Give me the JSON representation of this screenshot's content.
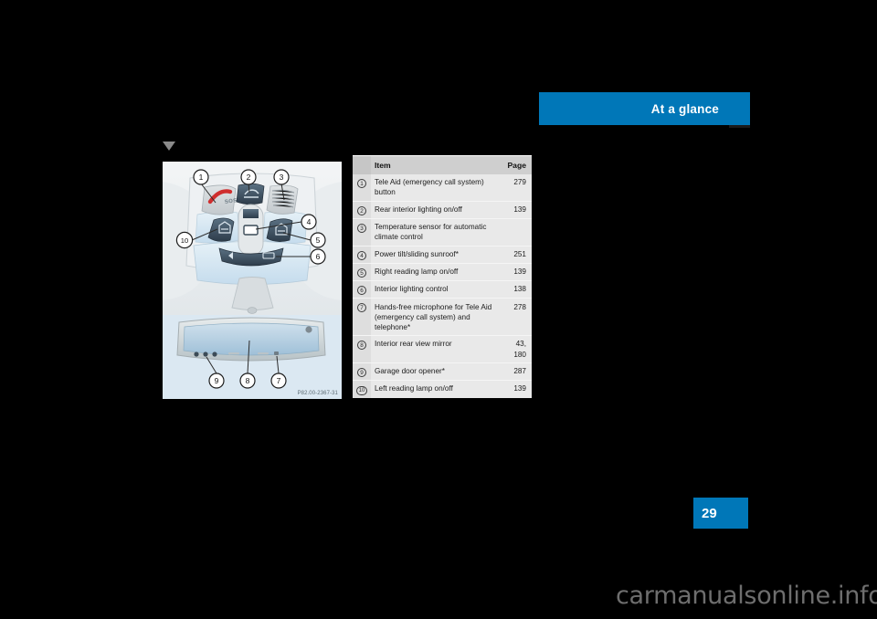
{
  "header": {
    "chapter_title": "At a glance",
    "accent_color": "#0077b8"
  },
  "section_marker": {
    "icon": "triangle-down-icon"
  },
  "figure": {
    "caption_code": "P82.00-2367-31",
    "alt": "Overhead console and interior rear view mirror",
    "callouts": [
      "1",
      "2",
      "3",
      "4",
      "5",
      "6",
      "7",
      "8",
      "9",
      "10"
    ]
  },
  "table": {
    "headers": {
      "number": "",
      "item": "Item",
      "page": "Page"
    },
    "rows": [
      {
        "num": "1",
        "item": "Tele Aid (emergency call system) button",
        "page": "279"
      },
      {
        "num": "2",
        "item": "Rear interior lighting on/off",
        "page": "139"
      },
      {
        "num": "3",
        "item": "Temperature sensor for automatic climate control",
        "page": ""
      },
      {
        "num": "4",
        "item": "Power tilt/sliding sunroof*",
        "page": "251"
      },
      {
        "num": "5",
        "item": "Right reading lamp on/off",
        "page": "139"
      },
      {
        "num": "6",
        "item": "Interior lighting control",
        "page": "138"
      },
      {
        "num": "7",
        "item": "Hands-free microphone for Tele Aid (emergency call system) and telephone*",
        "page": "278"
      },
      {
        "num": "8",
        "item": "Interior rear view mirror",
        "page": "43,\n180"
      },
      {
        "num": "9",
        "item": "Garage door opener*",
        "page": "287"
      },
      {
        "num": "10",
        "item": "Left reading lamp on/off",
        "page": "139"
      }
    ]
  },
  "footer": {
    "page_number": "29",
    "watermark": "carmanualsonline.info"
  }
}
